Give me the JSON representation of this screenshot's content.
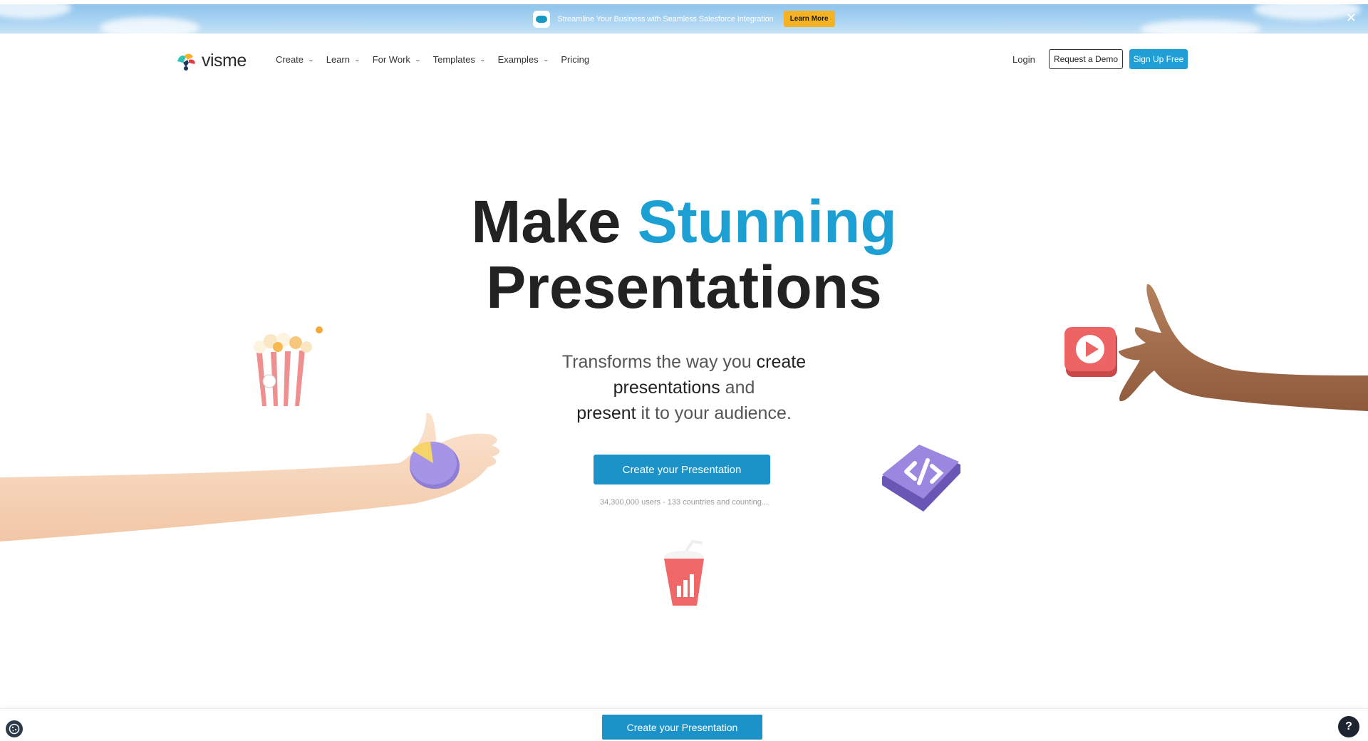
{
  "promo": {
    "text": "Streamline Your Business with Seamless Salesforce Integration",
    "button_label": "Learn More",
    "close_label": "✕"
  },
  "header": {
    "logo_text": "visme",
    "nav": [
      {
        "label": "Create"
      },
      {
        "label": "Learn"
      },
      {
        "label": "For Work"
      },
      {
        "label": "Templates"
      },
      {
        "label": "Examples"
      },
      {
        "label": "Pricing"
      }
    ],
    "login_label": "Login",
    "demo_label": "Request a Demo",
    "signup_label": "Sign Up Free"
  },
  "hero": {
    "title_part1": "Make",
    "title_accent": "Stunning",
    "title_line2": "Presentations",
    "sub_1": "Transforms the way you",
    "sub_2": "create",
    "sub_3": "presentations",
    "sub_4": "and",
    "sub_5": "present",
    "sub_6": "it to your audience.",
    "cta_label": "Create your Presentation",
    "stats": "34,300,000 users - 133 countries and counting..."
  },
  "bottom_bar": {
    "cta_label": "Create your Presentation",
    "help_label": "?"
  },
  "colors": {
    "accent": "#1ca0d4",
    "cta": "#1c93c8",
    "promo_button": "#f5b323"
  },
  "icons": [
    "close-icon",
    "chevron-down-icon",
    "cookie-icon",
    "help-icon",
    "popcorn-illustration",
    "pie-chart-illustration",
    "code-tile-illustration",
    "play-tile-illustration",
    "soda-cup-illustration"
  ]
}
